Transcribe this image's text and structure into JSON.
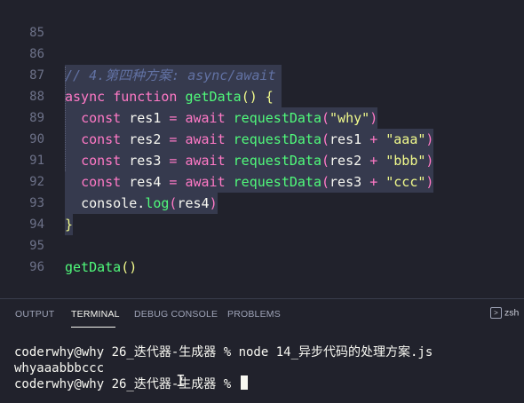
{
  "editor": {
    "lines": [
      {
        "num": "85"
      },
      {
        "num": "86",
        "comment": "// 4.第四种方案: async/await"
      },
      {
        "num": "87",
        "kw": "async",
        "kw2": "function",
        "fn": "getData",
        "paren": "()",
        "brace": "{"
      },
      {
        "num": "88",
        "kw": "const",
        "name": "res1",
        "eq": "=",
        "aw": "await",
        "fn": "requestData",
        "open": "(",
        "arg": "\"why\"",
        "close": ")"
      },
      {
        "num": "89",
        "kw": "const",
        "name": "res2",
        "eq": "=",
        "aw": "await",
        "fn": "requestData",
        "open": "(",
        "argv": "res1",
        "plus": "+",
        "arg": "\"aaa\"",
        "close": ")"
      },
      {
        "num": "90",
        "kw": "const",
        "name": "res3",
        "eq": "=",
        "aw": "await",
        "fn": "requestData",
        "open": "(",
        "argv": "res2",
        "plus": "+",
        "arg": "\"bbb\"",
        "close": ")"
      },
      {
        "num": "91",
        "kw": "const",
        "name": "res4",
        "eq": "=",
        "aw": "await",
        "fn": "requestData",
        "open": "(",
        "argv": "res3",
        "plus": "+",
        "arg": "\"ccc\"",
        "close": ")"
      },
      {
        "num": "92",
        "obj": "console",
        "dot": ".",
        "fn": "log",
        "open": "(",
        "argv": "res4",
        "close": ")"
      },
      {
        "num": "93",
        "brace": "}"
      },
      {
        "num": "94"
      },
      {
        "num": "95",
        "fn": "getData",
        "paren": "()"
      },
      {
        "num": "96"
      }
    ]
  },
  "panel": {
    "tabs": [
      "OUTPUT",
      "TERMINAL",
      "DEBUG CONSOLE",
      "PROBLEMS"
    ],
    "active_tab": "TERMINAL",
    "shell_label": "zsh",
    "terminal": {
      "line1": "coderwhy@why 26_迭代器-生成器 % node 14_异步代码的处理方案.js",
      "line2": "whyaaabbbccc",
      "line3": "coderwhy@why 26_迭代器-生成器 % "
    }
  },
  "colors": {
    "background": "#21222c",
    "keyword": "#ff79c6",
    "function": "#50fa7b",
    "string": "#f1fa8c",
    "comment": "#6272a4",
    "selection": "#363a4e"
  }
}
